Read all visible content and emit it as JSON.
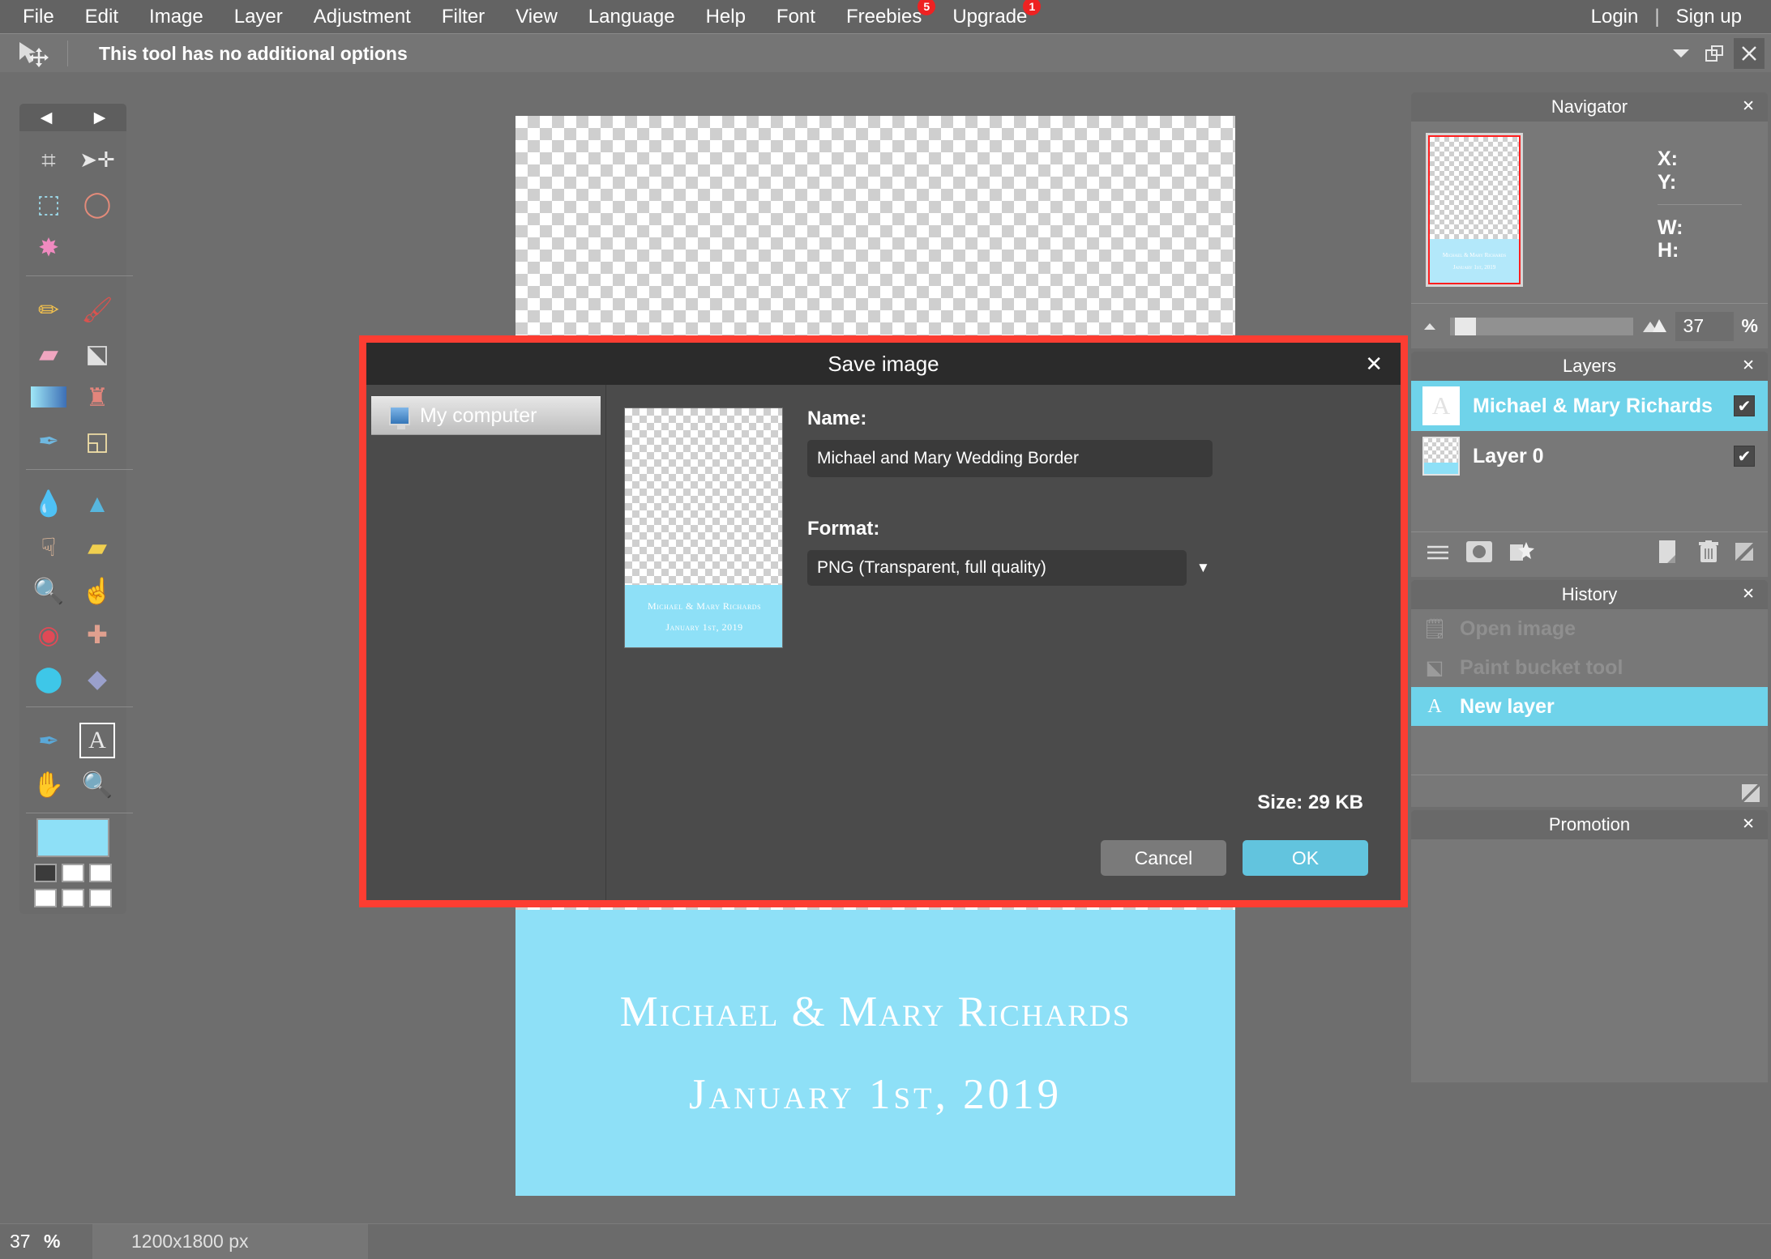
{
  "app": {
    "menu": [
      {
        "label": "File"
      },
      {
        "label": "Edit"
      },
      {
        "label": "Image"
      },
      {
        "label": "Layer"
      },
      {
        "label": "Adjustment"
      },
      {
        "label": "Filter"
      },
      {
        "label": "View"
      },
      {
        "label": "Language"
      },
      {
        "label": "Help"
      },
      {
        "label": "Font"
      },
      {
        "label": "Freebies",
        "badge": "5"
      },
      {
        "label": "Upgrade",
        "badge": "1"
      }
    ],
    "account": {
      "login": "Login",
      "divider": "|",
      "signup": "Sign up"
    }
  },
  "options_bar": {
    "tool_icon": "move-tool-icon",
    "text": "This tool has no additional options",
    "window_buttons": [
      "chevron-down-icon",
      "restore-icon",
      "close-icon"
    ]
  },
  "toolbar": {
    "prev_arrow": "◀",
    "next_arrow": "▶",
    "tools": [
      {
        "name": "crop-tool",
        "glyph": "✀"
      },
      {
        "name": "move-tool",
        "glyph": "✣"
      },
      {
        "name": "marquee-select-tool",
        "glyph": "⬚"
      },
      {
        "name": "lasso-tool",
        "glyph": "⟲"
      },
      {
        "name": "magic-wand-tool",
        "glyph": "✦"
      },
      {
        "name": "pencil-tool",
        "glyph": "✎"
      },
      {
        "name": "brush-tool",
        "glyph": "🖌"
      },
      {
        "name": "eraser-tool",
        "glyph": "▭"
      },
      {
        "name": "paint-bucket-tool",
        "glyph": "⬟"
      },
      {
        "name": "gradient-tool",
        "glyph": "■"
      },
      {
        "name": "clone-stamp-tool",
        "glyph": "⚑"
      },
      {
        "name": "replace-color-tool",
        "glyph": "✒"
      },
      {
        "name": "shape-tool",
        "glyph": "◰"
      },
      {
        "name": "blur-tool",
        "glyph": "💧"
      },
      {
        "name": "sharpen-tool",
        "glyph": "▲"
      },
      {
        "name": "smudge-tool",
        "glyph": "☛"
      },
      {
        "name": "sponge-tool",
        "glyph": "▢"
      },
      {
        "name": "dodge-tool",
        "glyph": "⚬"
      },
      {
        "name": "burn-tool",
        "glyph": "☞"
      },
      {
        "name": "red-eye-tool",
        "glyph": "◉"
      },
      {
        "name": "heal-tool",
        "glyph": "⚕"
      },
      {
        "name": "bloat-tool",
        "glyph": "⬤"
      },
      {
        "name": "pinch-tool",
        "glyph": "◆"
      },
      {
        "name": "eyedropper-tool",
        "glyph": "✐"
      },
      {
        "name": "text-tool",
        "glyph": "A",
        "selected": true
      },
      {
        "name": "hand-tool",
        "glyph": "✋"
      },
      {
        "name": "zoom-tool",
        "glyph": "🔍"
      }
    ],
    "primary_color": "#8ee0f7",
    "palette": [
      "#3b3b3b",
      "#ffffff",
      "#ffffff",
      "#ffffff",
      "#ffffff",
      "#ffffff"
    ]
  },
  "canvas": {
    "line1": "Michael & Mary Richards",
    "line2": "January 1st, 2019",
    "band_color": "#8ee0f7"
  },
  "dialog": {
    "title": "Save image",
    "close_icon": "close-icon",
    "border_color": "#fc3d32",
    "source": {
      "icon": "monitor-icon",
      "label": "My computer"
    },
    "preview": {
      "line1": "Michael & Mary Richards",
      "line2": "January 1st, 2019"
    },
    "name_label": "Name:",
    "name_value": "Michael and Mary Wedding Border",
    "format_label": "Format:",
    "format_value": "PNG (Transparent, full quality)",
    "format_caret": "▼",
    "size_label": "Size: 29 KB",
    "cancel_label": "Cancel",
    "ok_label": "OK",
    "ok_color": "#62c4de"
  },
  "panels": {
    "navigator": {
      "title": "Navigator",
      "close_icon": "close-icon",
      "thumb_line1": "Michael & Mary Richards",
      "thumb_line2": "January 1st, 2019",
      "x_label": "X:",
      "y_label": "Y:",
      "w_label": "W:",
      "h_label": "H:",
      "zoom_value": "37",
      "zoom_unit": "%",
      "zoom_out_icon": "small-mountain-icon",
      "zoom_in_icon": "large-mountain-icon"
    },
    "layers": {
      "title": "Layers",
      "close_icon": "close-icon",
      "items": [
        {
          "name": "Michael & Mary Richards",
          "thumb": "text-layer-thumb",
          "visible": "✔",
          "selected": true
        },
        {
          "name": "Layer 0",
          "thumb": "checker-layer-thumb",
          "visible": "✔",
          "selected": false
        }
      ],
      "toolbar_icons": [
        "layer-settings-icon",
        "layer-mask-icon",
        "layer-effects-icon",
        "duplicate-layer-icon",
        "delete-layer-icon"
      ]
    },
    "history": {
      "title": "History",
      "close_icon": "close-icon",
      "items": [
        {
          "label": "Open image",
          "icon": "open-image-icon",
          "selected": false
        },
        {
          "label": "Paint bucket tool",
          "icon": "paint-bucket-icon",
          "selected": false
        },
        {
          "label": "New layer",
          "icon": "text-layer-icon",
          "selected": true
        }
      ]
    },
    "promotion": {
      "title": "Promotion",
      "close_icon": "close-icon"
    }
  },
  "status_bar": {
    "zoom": "37",
    "unit": "%",
    "dimensions": "1200x1800 px"
  }
}
